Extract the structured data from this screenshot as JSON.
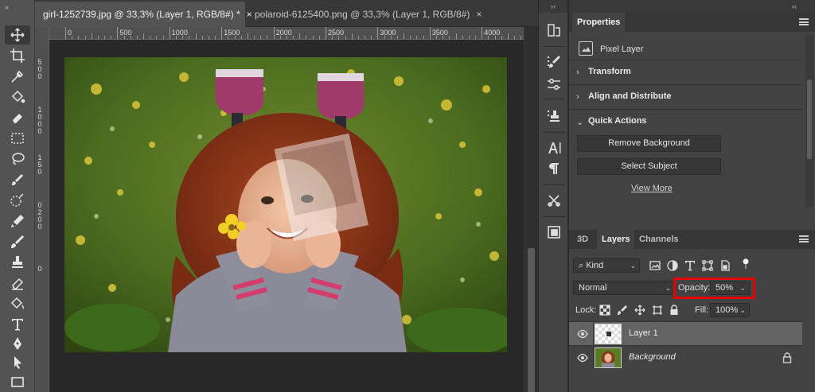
{
  "tabs": [
    {
      "label": "girl-1252739.jpg @ 33,3% (Layer 1, RGB/8#) *",
      "close": "×",
      "active": true
    },
    {
      "label": "polaroid-6125400.png @ 33,3% (Layer 1, RGB/8#)",
      "close": "×",
      "active": false
    }
  ],
  "ruler": {
    "labels": [
      "0",
      "500",
      "1000",
      "1500",
      "2000",
      "2500",
      "3000",
      "3500",
      "4000"
    ],
    "vertical_labels": [
      "5",
      "0",
      "0",
      "1",
      "0",
      "0",
      "0",
      "1",
      "5",
      "0",
      "0",
      "2",
      "0",
      "0",
      "0"
    ]
  },
  "toolbar": {
    "grip": "››",
    "tools": [
      "move-tool",
      "crop-tool",
      "eyedropper-tool",
      "paint-bucket-tool",
      "eraser-tool",
      "marquee-tool",
      "lasso-tool",
      "brush-tool",
      "quick-selection-tool",
      "color-replacement-tool",
      "brush-tool-2",
      "clone-stamp-tool",
      "eraser-tool-2",
      "paint-bucket-tool-2",
      "type-tool",
      "pen-tool",
      "path-selection-tool",
      "rectangle-tool"
    ]
  },
  "strip": {
    "grip": "››"
  },
  "properties": {
    "grip": "‹‹",
    "tab": "Properties",
    "layer_type": "Pixel Layer",
    "sections": [
      "Transform",
      "Align and Distribute",
      "Quick Actions"
    ],
    "buttons": [
      "Remove Background",
      "Select Subject"
    ],
    "view_more": "View More"
  },
  "layers_panel": {
    "tabs": [
      "3D",
      "Layers",
      "Channels"
    ],
    "kind": "Kind",
    "blend_mode": "Normal",
    "opacity_label": "Opacity:",
    "opacity_value": "50%",
    "lock_label": "Lock:",
    "fill_label": "Fill:",
    "fill_value": "100%",
    "layers": [
      {
        "name": "Layer 1",
        "selected": true,
        "italic": false
      },
      {
        "name": "Background",
        "selected": false,
        "italic": true,
        "locked": true
      }
    ]
  },
  "colors": {
    "highlight": "#e60000",
    "ui_dark": "#282828",
    "ui_panel": "#424242"
  }
}
